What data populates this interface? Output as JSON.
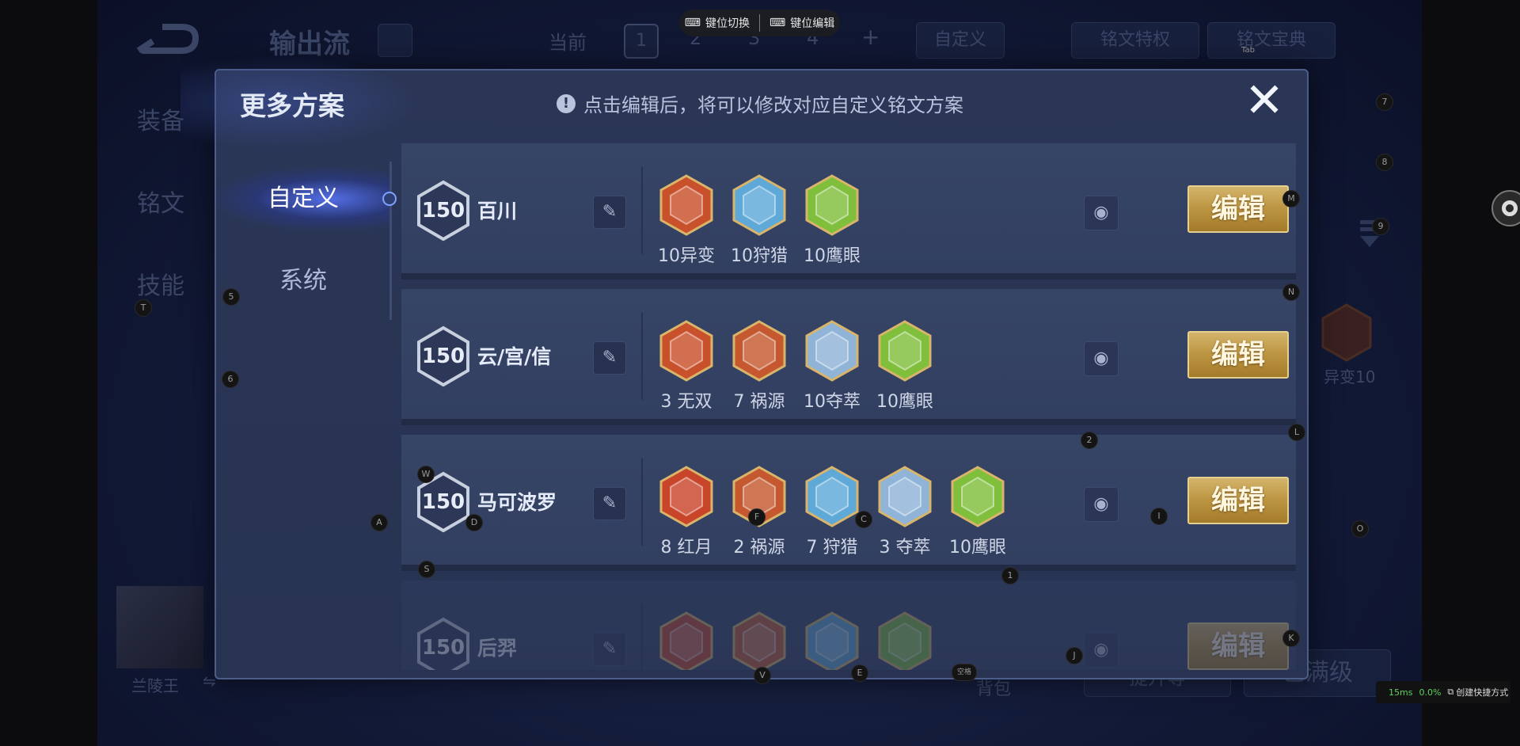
{
  "toolbar": {
    "key_switch": "键位切换",
    "key_edit": "键位编辑"
  },
  "background": {
    "tab_title": "输出流",
    "current_label": "当前",
    "pages": [
      "1",
      "2",
      "3",
      "4"
    ],
    "plus": "+",
    "custom_btn": "自定义",
    "privilege_btn": "铭文特权",
    "codex_btn": "铭文宝典",
    "codex_key": "Tab",
    "side_nav": [
      "装备",
      "铭文",
      "技能"
    ],
    "hero_name": "兰陵王",
    "swap_icon": "⇋",
    "bag": "背包",
    "upgrade": "提升等",
    "maxed": "已满级",
    "right_rune_label": "异变10"
  },
  "modal": {
    "title": "更多方案",
    "tip": "点击编辑后，将可以修改对应自定义铭文方案",
    "close": "✕",
    "tabs": [
      {
        "label": "自定义"
      },
      {
        "label": "系统"
      }
    ],
    "edit_label": "编辑",
    "cards": [
      {
        "level": "150",
        "name": "百川",
        "runes": [
          {
            "label": "10异变",
            "color": "#c8502a",
            "icon": "yibian-rune-icon"
          },
          {
            "label": "10狩猎",
            "color": "#5fa9d8",
            "icon": "shoulie-rune-icon"
          },
          {
            "label": "10鹰眼",
            "color": "#7fbf3c",
            "icon": "yingyan-rune-icon"
          }
        ]
      },
      {
        "level": "150",
        "name": "云/宫/信",
        "runes": [
          {
            "label": "3 无双",
            "color": "#c8502a",
            "icon": "wushuang-rune-icon"
          },
          {
            "label": "7 祸源",
            "color": "#c5582f",
            "icon": "huoyuan-rune-icon"
          },
          {
            "label": "10夺萃",
            "color": "#8fb4d8",
            "icon": "duocui-rune-icon"
          },
          {
            "label": "10鹰眼",
            "color": "#7fbf3c",
            "icon": "yingyan-rune-icon"
          }
        ]
      },
      {
        "level": "150",
        "name": "马可波罗",
        "runes": [
          {
            "label": "8 红月",
            "color": "#c8452a",
            "icon": "hongyue-rune-icon"
          },
          {
            "label": "2 祸源",
            "color": "#c5582f",
            "icon": "huoyuan-rune-icon"
          },
          {
            "label": "7 狩猎",
            "color": "#5fa9d8",
            "icon": "shoulie-rune-icon"
          },
          {
            "label": "3 夺萃",
            "color": "#8fb4d8",
            "icon": "duocui-rune-icon"
          },
          {
            "label": "10鹰眼",
            "color": "#7fbf3c",
            "icon": "yingyan-rune-icon"
          }
        ]
      },
      {
        "level": "150",
        "name": "后羿",
        "runes": [
          {
            "label": "",
            "color": "#c8452a",
            "icon": "hongyue-rune-icon"
          },
          {
            "label": "",
            "color": "#c5582f",
            "icon": "huoyuan-rune-icon"
          },
          {
            "label": "",
            "color": "#5fa9d8",
            "icon": "shoulie-rune-icon"
          },
          {
            "label": "",
            "color": "#7fbf3c",
            "icon": "yingyan-rune-icon"
          }
        ]
      }
    ]
  },
  "key_hints": [
    "7",
    "8",
    "9",
    "M",
    "N",
    "L",
    "2",
    "O",
    "I",
    "C",
    "F",
    "W",
    "D",
    "A",
    "S",
    "1",
    "J",
    "K",
    "V",
    "E",
    "空格",
    "T",
    "5",
    "6"
  ],
  "status": {
    "latency": "15ms",
    "cpu": "0.0%",
    "shortcut": "创建快捷方式"
  }
}
